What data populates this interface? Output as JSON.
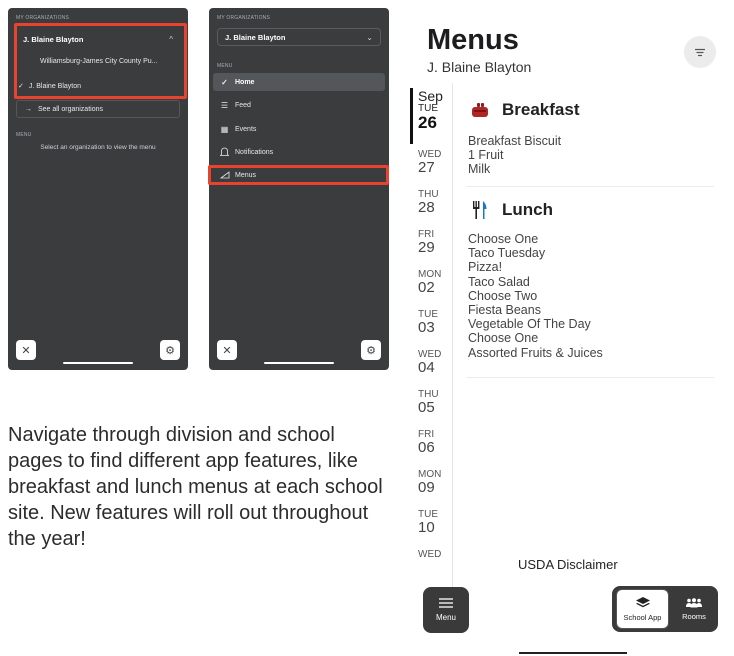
{
  "phone_a": {
    "section_orgs": "MY ORGANIZATIONS",
    "selected_org": "J. Blaine Blayton",
    "chevron": "^",
    "dropdown_items": [
      "Williamsburg-James City County Pu...",
      "J. Blaine Blayton"
    ],
    "check": "✓",
    "see_all": "See all organizations",
    "see_all_arrow": "→",
    "section_menu": "MENU",
    "empty_msg": "Select an organization to view the menu",
    "close_glyph": "✕",
    "settings_glyph": "⚙"
  },
  "phone_b": {
    "section_orgs": "MY ORGANIZATIONS",
    "selected_org": "J. Blaine Blayton",
    "chevron": "⌄",
    "section_menu": "MENU",
    "nav": [
      {
        "label": "Home",
        "icon": "check-icon",
        "glyph": "✓"
      },
      {
        "label": "Feed",
        "icon": "feed-icon",
        "glyph": "☰"
      },
      {
        "label": "Events",
        "icon": "calendar-icon",
        "glyph": "▦"
      },
      {
        "label": "Notifications",
        "icon": "bell-icon",
        "glyph": "♫"
      },
      {
        "label": "Menus",
        "icon": "pizza-icon",
        "glyph": "◺"
      }
    ],
    "close_glyph": "✕",
    "settings_glyph": "⚙"
  },
  "caption": "Navigate through division and school pages to find different app features, like breakfast and lunch menus at each school site. New features will roll out throughout the year!",
  "menu": {
    "title": "Menus",
    "subtitle": "J. Blaine Blayton",
    "dates": [
      {
        "mon": "Sep",
        "dw": "TUE",
        "dn": "26",
        "active": true
      },
      {
        "dw": "WED",
        "dn": "27"
      },
      {
        "dw": "THU",
        "dn": "28"
      },
      {
        "dw": "FRI",
        "dn": "29"
      },
      {
        "dw": "MON",
        "dn": "02"
      },
      {
        "dw": "TUE",
        "dn": "03"
      },
      {
        "dw": "WED",
        "dn": "04"
      },
      {
        "dw": "THU",
        "dn": "05"
      },
      {
        "dw": "FRI",
        "dn": "06"
      },
      {
        "dw": "MON",
        "dn": "09"
      },
      {
        "dw": "TUE",
        "dn": "10"
      },
      {
        "dw": "WED",
        "dn": ""
      }
    ],
    "breakfast": {
      "title": "Breakfast",
      "items": [
        "Breakfast Biscuit",
        "1 Fruit",
        "Milk"
      ]
    },
    "lunch": {
      "title": "Lunch",
      "items": [
        "Choose One",
        "Taco Tuesday",
        "Pizza!",
        "Taco Salad",
        "Choose Two",
        "Fiesta Beans",
        "Vegetable Of The Day",
        "Choose One",
        "Assorted Fruits & Juices"
      ]
    },
    "usda": "USDA Disclaimer",
    "tabs": {
      "menu": "Menu",
      "school_app": "School App",
      "rooms": "Rooms"
    }
  },
  "colors": {
    "phone_bg": "#3a3c3e",
    "highlight": "#e8432f",
    "tab_bg": "#3a3a3a"
  }
}
